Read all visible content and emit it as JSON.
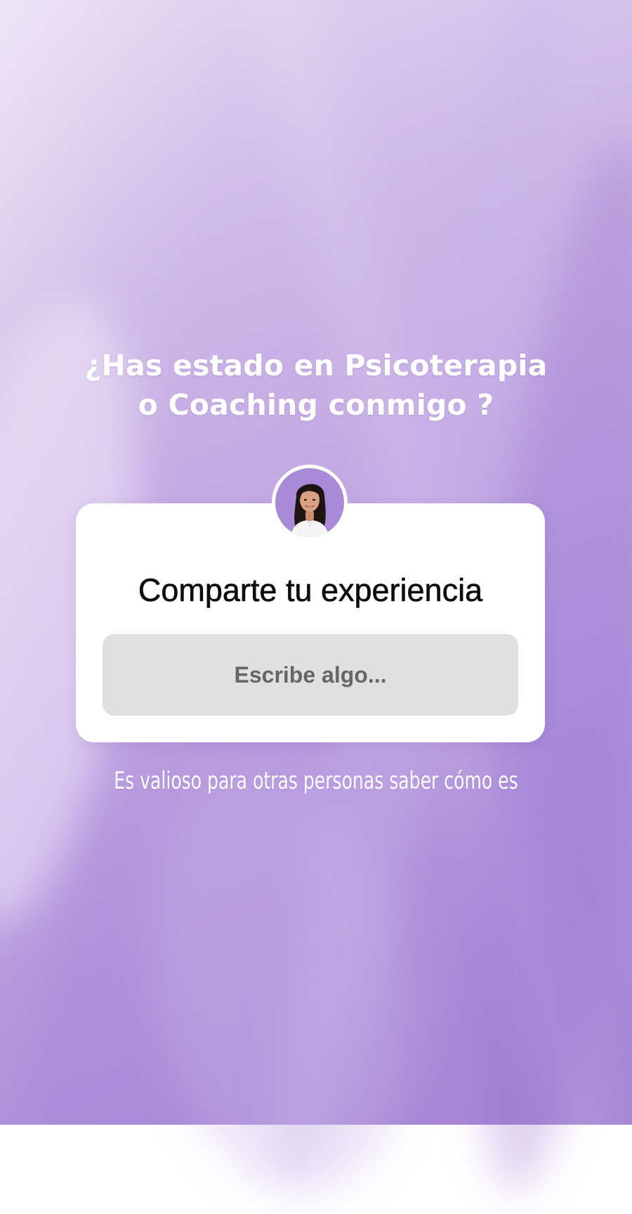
{
  "story": {
    "heading_line1": "¿Has estado en Psicoterapia",
    "heading_line2": "o Coaching conmigo ?",
    "caption": "Es valioso para otras personas saber cómo es"
  },
  "question_sticker": {
    "title": "Comparte tu experiencia",
    "input_placeholder": "Escribe algo...",
    "input_value": "",
    "avatar_icon": "profile-photo-woman"
  },
  "colors": {
    "background_top": "#e4d8f3",
    "background_bottom": "#a684d3",
    "avatar_background": "#a98ad6",
    "card_background": "#ffffff",
    "input_background": "#e0e0e0",
    "title_text": "#0d0d0d",
    "placeholder_text": "#666666"
  }
}
